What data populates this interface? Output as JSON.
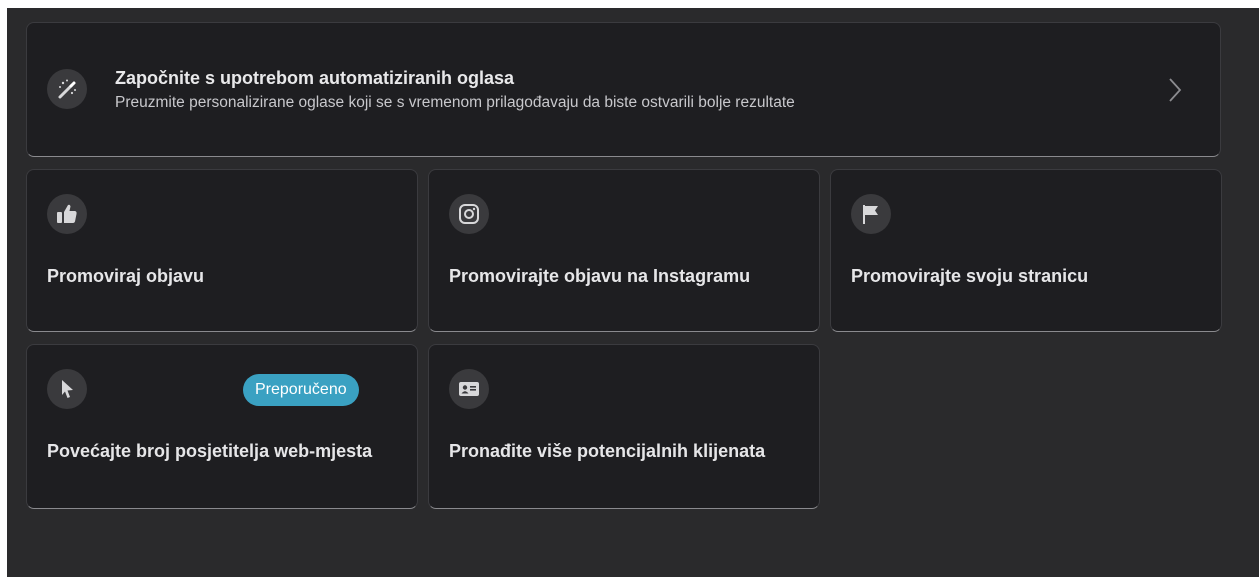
{
  "hero": {
    "title": "Započnite s upotrebom automatiziranih oglasa",
    "subtitle": "Preuzmite personalizirane oglase koji se s vremenom prilagođavaju da biste ostvarili bolje rezultate",
    "icon": "magic-wand-icon"
  },
  "options": [
    {
      "label": "Promoviraj objavu",
      "icon": "thumbs-up-icon"
    },
    {
      "label": "Promovirajte objavu na Instagramu",
      "icon": "instagram-icon"
    },
    {
      "label": "Promovirajte svoju stranicu",
      "icon": "flag-icon"
    },
    {
      "label": "Povećajte broj posjetitelja web-mjesta",
      "icon": "cursor-icon",
      "badge": "Preporučeno"
    },
    {
      "label": "Pronađite više potencijalnih klijenata",
      "icon": "contact-card-icon"
    }
  ],
  "colors": {
    "background": "#2a2a2c",
    "card": "#1e1e21",
    "badge": "#3aa1c2"
  }
}
